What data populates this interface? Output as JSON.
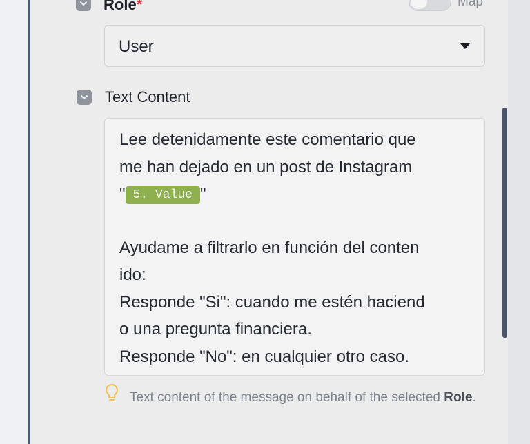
{
  "role_field": {
    "label": "Role",
    "required_marker": "*",
    "map_toggle_label": "Map",
    "selected_value": "User"
  },
  "text_content_field": {
    "label": "Text Content",
    "lines": [
      "Lee detenidamente este comentario que",
      "me han dejado en un post de Instagram",
      "",
      "",
      "Ayudame a filtrarlo en función del conten",
      "ido:",
      "Responde \"Si\": cuando me estén haciend",
      "o una pregunta financiera.",
      "Responde \"No\": en cualquier otro caso."
    ],
    "quote_open": "\"",
    "quote_close": "\"",
    "variable_chip": "5. Value"
  },
  "hint": {
    "text_prefix": "Text content of the message on behalf of the selected ",
    "text_bold": "Role",
    "text_suffix": "."
  },
  "colors": {
    "accent_blue": "#3a5ba8",
    "variable_chip_bg": "#8fb04f",
    "required_red": "#d9363e",
    "hint_icon": "#f2c14e"
  }
}
